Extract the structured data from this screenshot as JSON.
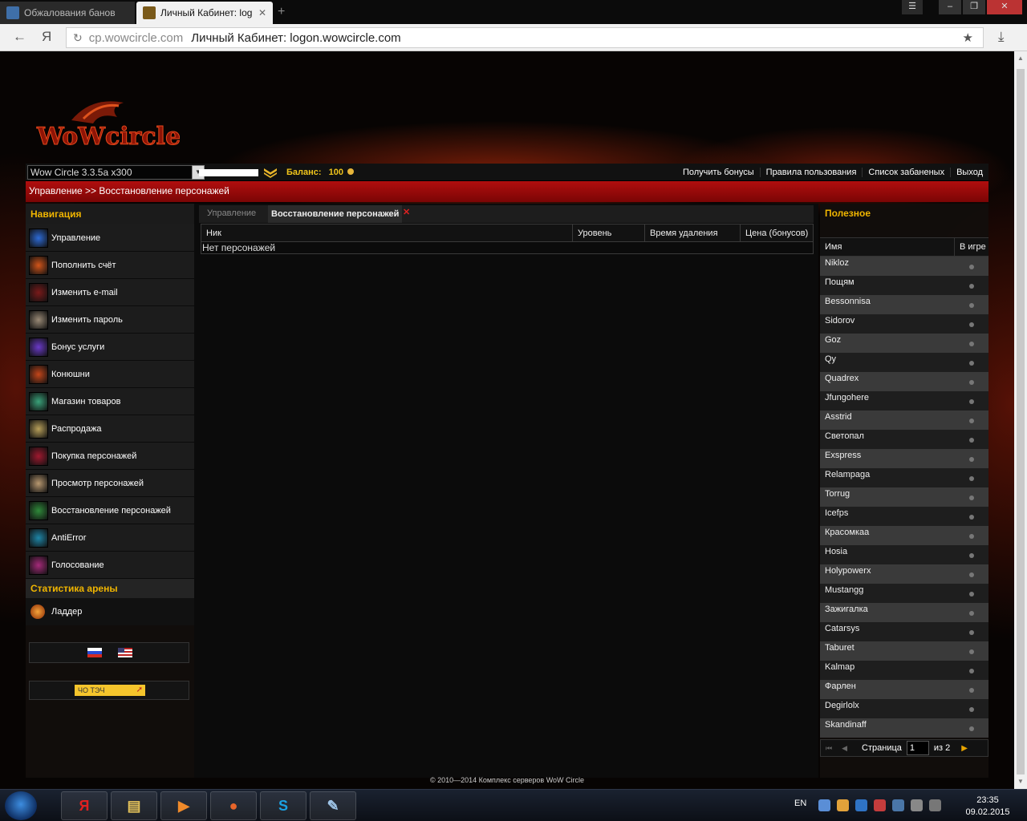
{
  "browser": {
    "tabs": [
      {
        "label": "Обжалования банов"
      },
      {
        "label": "Личный Кабинет: log"
      }
    ],
    "address": {
      "host": "cp.wowcircle.com",
      "title": "Личный Кабинет: logon.wowcircle.com"
    },
    "back_glyph": "←",
    "home_glyph": "Я"
  },
  "site": {
    "logo_text": "WoWcircle",
    "server": "Wow Circle 3.3.5a x300",
    "balance_label": "Баланс:",
    "balance_value": "100",
    "top_links": [
      "Получить бонусы",
      "Правила пользования",
      "Список забаненых",
      "Выход"
    ],
    "breadcrumb": "Управление >> Восстановление персонажей"
  },
  "nav": {
    "header": "Навигация",
    "items": [
      {
        "label": "Управление",
        "icon": "manage-icon",
        "color": "#2d6bd6"
      },
      {
        "label": "Пополнить счёт",
        "icon": "topup-icon",
        "color": "#d2551a"
      },
      {
        "label": "Изменить e-mail",
        "icon": "email-icon",
        "color": "#7a1a1a"
      },
      {
        "label": "Изменить пароль",
        "icon": "password-icon",
        "color": "#9a8a76"
      },
      {
        "label": "Бонус услуги",
        "icon": "bonus-icon",
        "color": "#6a3ac8"
      },
      {
        "label": "Конюшни",
        "icon": "stables-icon",
        "color": "#c4461a"
      },
      {
        "label": "Магазин товаров",
        "icon": "shop-icon",
        "color": "#3aa27a"
      },
      {
        "label": "Распродажа",
        "icon": "sale-icon",
        "color": "#b8a05a"
      },
      {
        "label": "Покупка персонажей",
        "icon": "buy-char-icon",
        "color": "#a0192f"
      },
      {
        "label": "Просмотр персонажей",
        "icon": "view-char-icon",
        "color": "#b89870"
      },
      {
        "label": "Восстановление персонажей",
        "icon": "restore-char-icon",
        "color": "#2f8a3a"
      },
      {
        "label": "AntiError",
        "icon": "antierror-icon",
        "color": "#1e86a8"
      },
      {
        "label": "Голосование",
        "icon": "vote-icon",
        "color": "#a52a7a"
      }
    ],
    "arena_header": "Статистика арены",
    "ladder": "Ладдер",
    "vote_banner": "ЧО ТЭЧ"
  },
  "main": {
    "tabs": [
      "Управление",
      "Восстановление персонажей"
    ],
    "close_glyph": "✕",
    "columns": [
      "Ник",
      "Уровень",
      "Время удаления",
      "Цена (бонусов)"
    ],
    "empty": "Нет персонажей"
  },
  "right": {
    "header": "Полезное",
    "columns": [
      "Имя",
      "В игре"
    ],
    "players": [
      "Nikloz",
      "Пощям",
      "Bessonnisa",
      "Sidorov",
      "Goz",
      "Qy",
      "Quadrex",
      "Jfungohere",
      "Asstrid",
      "Светопал",
      "Exspress",
      "Relampaga",
      "Torrug",
      "Icefps",
      "Красомкаа",
      "Hosia",
      "Holypowerx",
      "Mustangg",
      "Зажигалка",
      "Catarsys",
      "Taburet",
      "Kalmap",
      "Фарлен",
      "Degirlolx",
      "Skandinaff"
    ],
    "pager": {
      "label": "Страница",
      "page": "1",
      "of": "из 2"
    }
  },
  "footer": "© 2010—2014 Комплекс серверов WoW Circle",
  "taskbar": {
    "lang": "EN",
    "time": "23:35",
    "date": "09.02.2015",
    "apps": [
      {
        "glyph": "Я",
        "icon": "yandex-browser-icon",
        "color": "#e02020"
      },
      {
        "glyph": "▤",
        "icon": "explorer-icon",
        "color": "#e5c35a"
      },
      {
        "glyph": "▶",
        "icon": "media-player-icon",
        "color": "#f08a2a"
      },
      {
        "glyph": "●",
        "icon": "firefox-icon",
        "color": "#e8652a"
      },
      {
        "glyph": "S",
        "icon": "skype-icon",
        "color": "#1ba1e2"
      },
      {
        "glyph": "✎",
        "icon": "paint-icon",
        "color": "#9fc5e8"
      }
    ]
  }
}
